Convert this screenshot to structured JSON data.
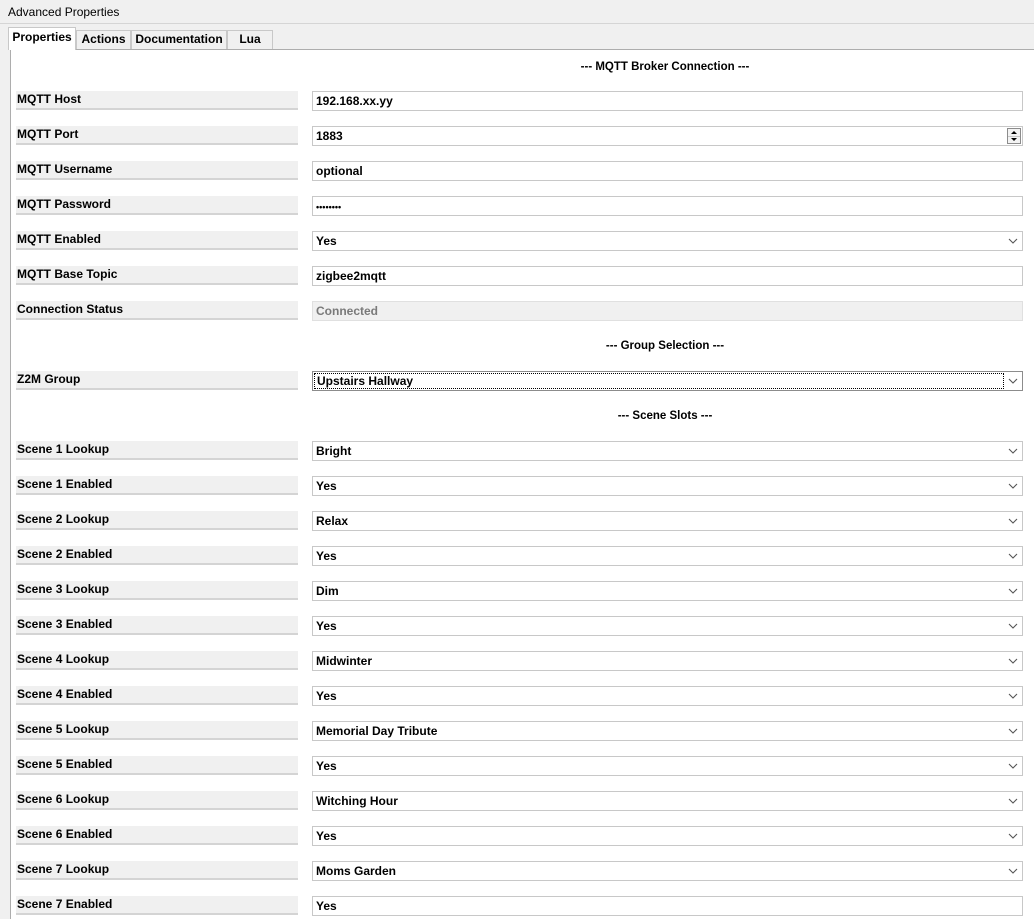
{
  "window": {
    "title": "Advanced Properties"
  },
  "tabs": [
    {
      "label": "Properties",
      "active": true
    },
    {
      "label": "Actions",
      "active": false
    },
    {
      "label": "Documentation",
      "active": false
    },
    {
      "label": "Lua",
      "active": false
    }
  ],
  "sections": {
    "mqtt": "--- MQTT Broker Connection ---",
    "group": "--- Group Selection ---",
    "scenes": "--- Scene Slots ---"
  },
  "properties": {
    "mqtt_host": {
      "label": "MQTT Host",
      "value": "192.168.xx.yy"
    },
    "mqtt_port": {
      "label": "MQTT Port",
      "value": "1883"
    },
    "mqtt_username": {
      "label": "MQTT Username",
      "value": "optional"
    },
    "mqtt_password": {
      "label": "MQTT Password",
      "value": "••••••••"
    },
    "mqtt_enabled": {
      "label": "MQTT Enabled",
      "value": "Yes"
    },
    "mqtt_base_topic": {
      "label": "MQTT Base Topic",
      "value": "zigbee2mqtt"
    },
    "connection_status": {
      "label": "Connection Status",
      "value": "Connected"
    },
    "z2m_group": {
      "label": "Z2M Group",
      "value": "Upstairs Hallway"
    },
    "scene1_lookup": {
      "label": "Scene 1 Lookup",
      "value": "Bright"
    },
    "scene1_enabled": {
      "label": "Scene 1 Enabled",
      "value": "Yes"
    },
    "scene2_lookup": {
      "label": "Scene 2 Lookup",
      "value": "Relax"
    },
    "scene2_enabled": {
      "label": "Scene 2 Enabled",
      "value": "Yes"
    },
    "scene3_lookup": {
      "label": "Scene 3 Lookup",
      "value": "Dim"
    },
    "scene3_enabled": {
      "label": "Scene 3 Enabled",
      "value": "Yes"
    },
    "scene4_lookup": {
      "label": "Scene 4 Lookup",
      "value": "Midwinter"
    },
    "scene4_enabled": {
      "label": "Scene 4 Enabled",
      "value": "Yes"
    },
    "scene5_lookup": {
      "label": "Scene 5 Lookup",
      "value": "Memorial Day Tribute"
    },
    "scene5_enabled": {
      "label": "Scene 5 Enabled",
      "value": "Yes"
    },
    "scene6_lookup": {
      "label": "Scene 6 Lookup",
      "value": "Witching Hour"
    },
    "scene6_enabled": {
      "label": "Scene 6 Enabled",
      "value": "Yes"
    },
    "scene7_lookup": {
      "label": "Scene 7 Lookup",
      "value": "Moms Garden"
    },
    "scene7_enabled": {
      "label": "Scene 7 Enabled",
      "value": "Yes"
    }
  },
  "colors": {
    "panel_bg": "#ffffff",
    "label_bg": "#f0f0f0",
    "border": "#c8c8c8",
    "disabled_text": "#7a7a7a"
  }
}
